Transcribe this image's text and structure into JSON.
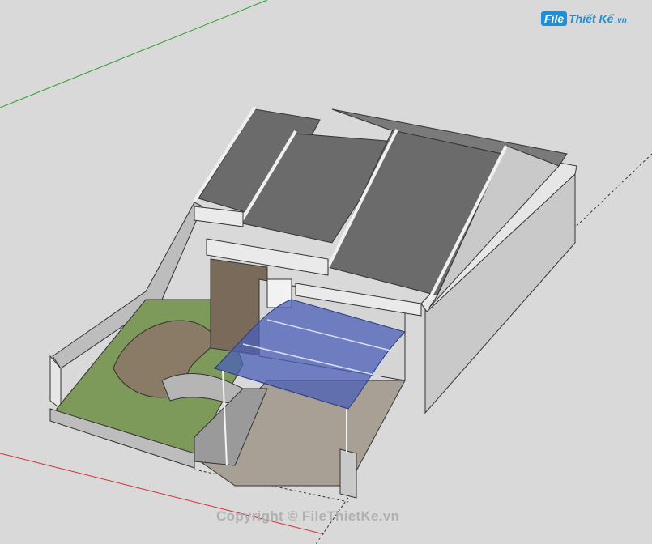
{
  "watermark_logo": {
    "file_label": "File",
    "brand_label": "Thiết Kế",
    "ext_label": ".vn"
  },
  "copyright": "Copyright © FileThietKe.vn",
  "colors": {
    "background": "#d9d9d9",
    "roof": "#6b6b6b",
    "wall": "#c9c9c9",
    "grass": "#7d9a5a",
    "canopy": "#4a5fb8",
    "axis_green": "#2aa02a",
    "axis_red": "#d03030"
  }
}
